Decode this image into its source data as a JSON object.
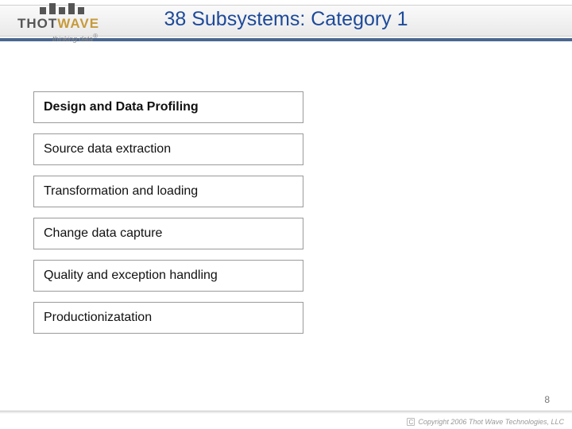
{
  "logo": {
    "word_a": "THOT",
    "word_b": "WAVE",
    "tagline": "thinking data",
    "reg": "®"
  },
  "title": "38 Subsystems: Category 1",
  "items": [
    {
      "label": "Design and Data Profiling",
      "active": true
    },
    {
      "label": "Source data extraction",
      "active": false
    },
    {
      "label": "Transformation and loading",
      "active": false
    },
    {
      "label": "Change data capture",
      "active": false
    },
    {
      "label": "Quality and exception handling",
      "active": false
    },
    {
      "label": "Productionizatation",
      "active": false
    }
  ],
  "page_number": "8",
  "copyright": "Copyright 2006 Thot Wave Technologies, LLC"
}
